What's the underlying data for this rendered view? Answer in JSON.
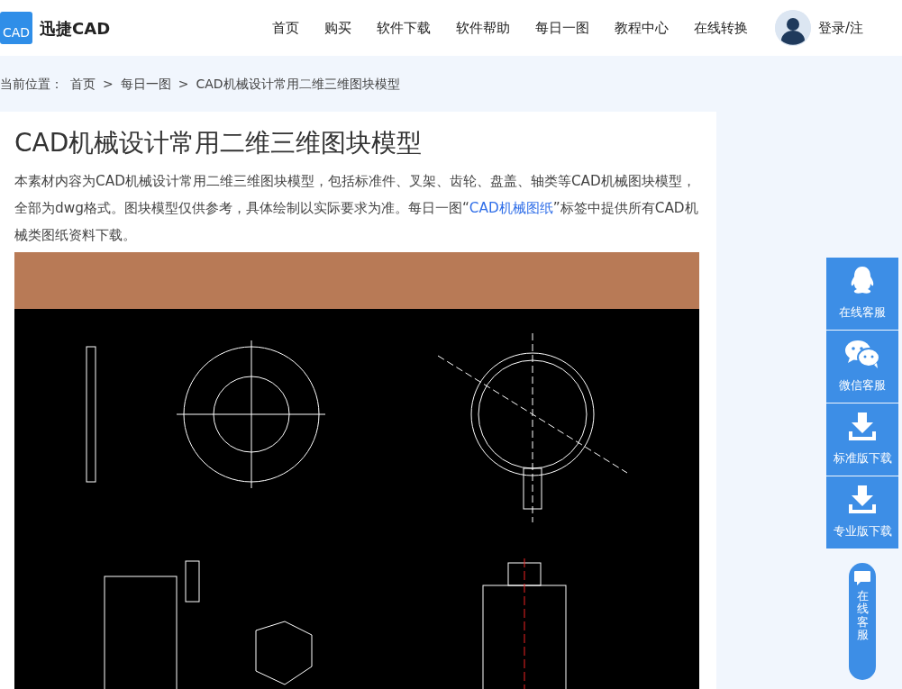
{
  "header": {
    "logo": {
      "badge": "CAD",
      "name": "迅捷CAD"
    },
    "nav": [
      {
        "label": "首页"
      },
      {
        "label": "购买"
      },
      {
        "label": "软件下载"
      },
      {
        "label": "软件帮助"
      },
      {
        "label": "每日一图"
      },
      {
        "label": "教程中心"
      },
      {
        "label": "在线转换"
      }
    ],
    "login": "登录/注"
  },
  "breadcrumb": {
    "label": "当前位置：",
    "separator": ">",
    "items": [
      "首页",
      "每日一图",
      "CAD机械设计常用二维三维图块模型"
    ]
  },
  "article": {
    "title": "CAD机械设计常用二维三维图块模型",
    "text_before": "本素材内容为CAD机械设计常用二维三维图块模型，包括标准件、叉架、齿轮、盘盖、轴类等CAD机械图块模型，全部为dwg格式。图块模型仅供参考，具体绘制以实际要求为准。每日一图“",
    "link": "CAD机械图纸",
    "text_after": "”标签中提供所有CAD机械类图纸资料下载。"
  },
  "float_bar": {
    "items": [
      {
        "kind": "qq",
        "label": "在线客服"
      },
      {
        "kind": "wechat",
        "label": "微信客服"
      },
      {
        "kind": "download",
        "label": "标准版下载"
      },
      {
        "kind": "download",
        "label": "专业版下载"
      }
    ]
  },
  "chat_pill": {
    "label": "在线客服"
  }
}
